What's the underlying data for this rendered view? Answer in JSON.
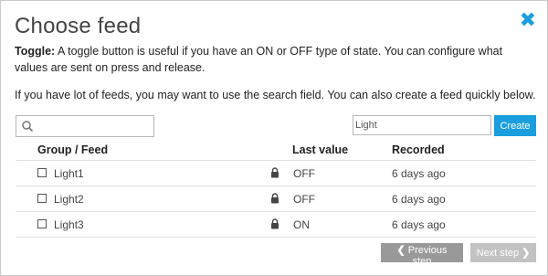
{
  "dialog": {
    "title": "Choose feed",
    "close_icon": "close-icon",
    "accent_color": "#1a9ede"
  },
  "description": {
    "bold_label": "Toggle:",
    "text": " A toggle button is useful if you have an ON or OFF type of state. You can configure what values are sent on press and release.",
    "search_hint": "If you have lot of feeds, you may want to use the search field. You can also create a feed quickly below."
  },
  "search": {
    "value": "",
    "icon": "search-icon"
  },
  "create": {
    "input_value": "Light",
    "button_label": "Create"
  },
  "table": {
    "headers": {
      "group_feed": "Group / Feed",
      "last_value": "Last value",
      "recorded": "Recorded"
    },
    "rows": [
      {
        "name": "Light1",
        "last_value": "OFF",
        "recorded": "6 days ago"
      },
      {
        "name": "Light2",
        "last_value": "OFF",
        "recorded": "6 days ago"
      },
      {
        "name": "Light3",
        "last_value": "ON",
        "recorded": "6 days ago"
      }
    ]
  },
  "footer": {
    "prev_label": "Previous step",
    "next_label": "Next step"
  }
}
